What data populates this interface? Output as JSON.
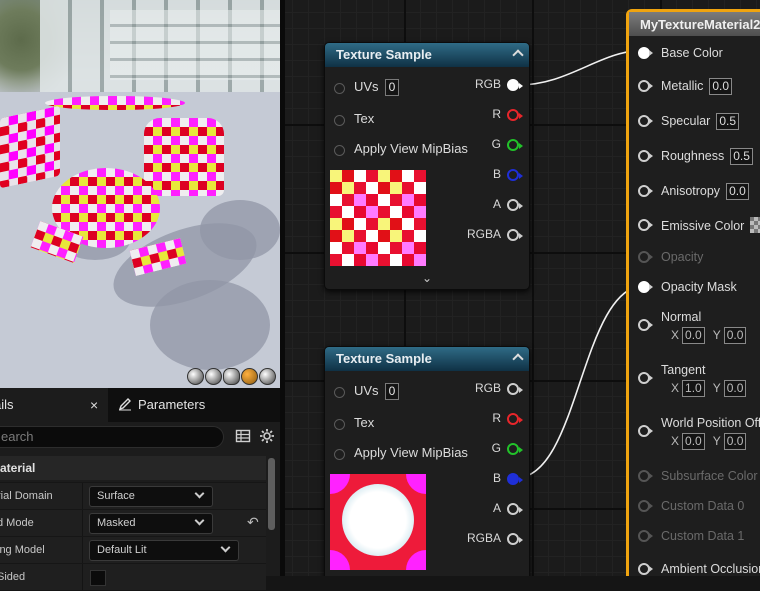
{
  "viewport": {
    "view_mode_icons": [
      "sphere-icon",
      "sphere-icon",
      "plane-icon",
      "cube-icon",
      "teapot-icon"
    ]
  },
  "details_panel": {
    "tab_details_label": "ails",
    "tab_close": "×",
    "tab_parameters_label": "Parameters",
    "search_placeholder": "earch",
    "section_title": "aterial",
    "properties": [
      {
        "label": "rial Domain",
        "value": "Surface"
      },
      {
        "label": "d Mode",
        "value": "Masked"
      },
      {
        "label": "ing Model",
        "value": "Default Lit"
      },
      {
        "label": "Sided",
        "value": ""
      }
    ],
    "reset_glyph": "↶"
  },
  "graph": {
    "texture_samples": [
      {
        "title": "Texture Sample",
        "inputs": [
          {
            "label": "UVs",
            "value": "0"
          },
          {
            "label": "Tex",
            "value": ""
          },
          {
            "label": "Apply View MipBias",
            "value": ""
          }
        ],
        "outputs": [
          {
            "label": "RGB",
            "color": "#ffffff",
            "connected": true
          },
          {
            "label": "R",
            "color": "#e8262b",
            "connected": false
          },
          {
            "label": "G",
            "color": "#22c22a",
            "connected": false
          },
          {
            "label": "B",
            "color": "#1f2fd8",
            "connected": false
          },
          {
            "label": "A",
            "color": "#cccccc",
            "connected": false
          },
          {
            "label": "RGBA",
            "color": "#cccccc",
            "connected": false
          }
        ],
        "expand_glyph": "⌄"
      },
      {
        "title": "Texture Sample",
        "inputs": [
          {
            "label": "UVs",
            "value": "0"
          },
          {
            "label": "Tex",
            "value": ""
          },
          {
            "label": "Apply View MipBias",
            "value": ""
          }
        ],
        "outputs": [
          {
            "label": "RGB",
            "color": "#cccccc",
            "connected": false
          },
          {
            "label": "R",
            "color": "#e8262b",
            "connected": false
          },
          {
            "label": "G",
            "color": "#22c22a",
            "connected": false
          },
          {
            "label": "B",
            "color": "#1f2fd8",
            "connected": true
          },
          {
            "label": "A",
            "color": "#cccccc",
            "connected": false
          },
          {
            "label": "RGBA",
            "color": "#cccccc",
            "connected": false
          }
        ]
      }
    ],
    "material_node": {
      "title": "MyTextureMaterial2",
      "inputs": [
        {
          "label": "Base Color",
          "value": "",
          "enabled": true,
          "connected": true
        },
        {
          "label": "Metallic",
          "value": "0.0",
          "enabled": true,
          "connected": false
        },
        {
          "label": "Specular",
          "value": "0.5",
          "enabled": true,
          "connected": false
        },
        {
          "label": "Roughness",
          "value": "0.5",
          "enabled": true,
          "connected": false
        },
        {
          "label": "Anisotropy",
          "value": "0.0",
          "enabled": true,
          "connected": false
        },
        {
          "label": "Emissive Color",
          "value": "",
          "enabled": true,
          "connected": false
        },
        {
          "label": "Opacity",
          "value": "",
          "enabled": false,
          "connected": false
        },
        {
          "label": "Opacity Mask",
          "value": "",
          "enabled": true,
          "connected": true
        },
        {
          "label": "Normal",
          "x": "0.0",
          "y": "0.0",
          "enabled": true,
          "connected": false
        },
        {
          "label": "Tangent",
          "x": "1.0",
          "y": "0.0",
          "enabled": true,
          "connected": false
        },
        {
          "label": "World Position Offset",
          "x": "0.0",
          "y": "0.0",
          "enabled": true,
          "connected": false
        },
        {
          "label": "Subsurface Color",
          "value": "",
          "enabled": false,
          "connected": false
        },
        {
          "label": "Custom Data 0",
          "value": "",
          "enabled": false,
          "connected": false
        },
        {
          "label": "Custom Data 1",
          "value": "",
          "enabled": false,
          "connected": false
        },
        {
          "label": "Ambient Occlusion",
          "value": "",
          "enabled": true,
          "connected": false
        }
      ],
      "x_label": "X",
      "y_label": "Y"
    },
    "colors": {
      "selection_outline": "#f0a40f",
      "header_blue": "#2f6b86"
    }
  }
}
